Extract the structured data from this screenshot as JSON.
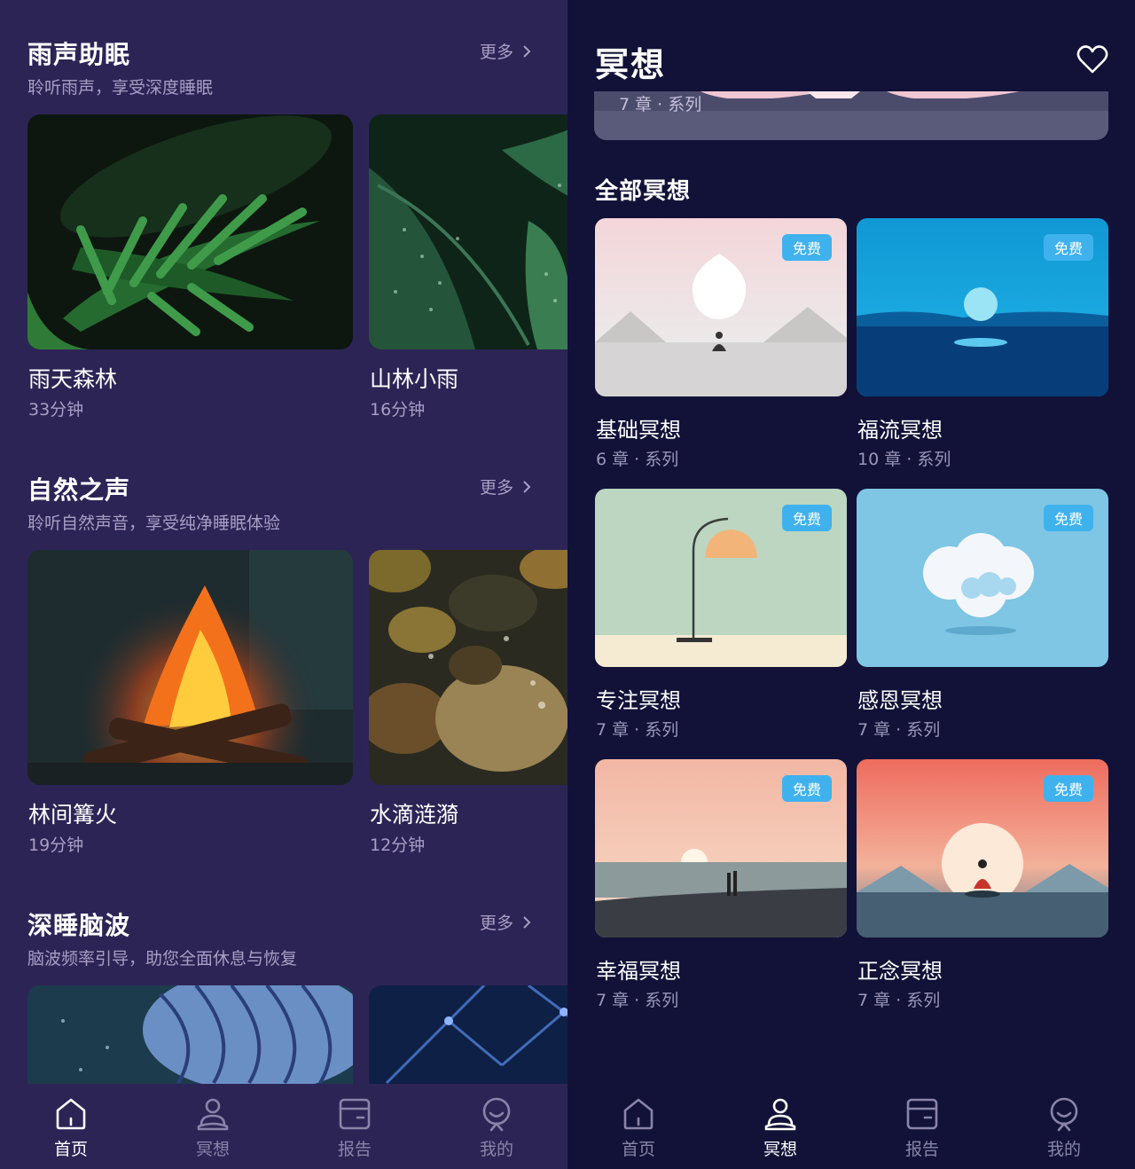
{
  "left_screen": {
    "sections": [
      {
        "title": "雨声助眠",
        "subtitle": "聆听雨声，享受深度睡眠",
        "more_label": "更多",
        "items": [
          {
            "title": "雨天森林",
            "duration": "33分钟"
          },
          {
            "title": "山林小雨",
            "duration": "16分钟"
          }
        ]
      },
      {
        "title": "自然之声",
        "subtitle": "聆听自然声音，享受纯净睡眠体验",
        "more_label": "更多",
        "items": [
          {
            "title": "林间篝火",
            "duration": "19分钟"
          },
          {
            "title": "水滴涟漪",
            "duration": "12分钟"
          }
        ]
      },
      {
        "title": "深睡脑波",
        "subtitle": "脑波频率引导，助您全面休息与恢复",
        "more_label": "更多",
        "items": [
          {
            "title": "",
            "duration": ""
          },
          {
            "title": "",
            "duration": ""
          }
        ]
      }
    ],
    "tabbar": [
      {
        "label": "首页",
        "icon": "home-icon",
        "active": true
      },
      {
        "label": "冥想",
        "icon": "meditation-icon",
        "active": false
      },
      {
        "label": "报告",
        "icon": "report-icon",
        "active": false
      },
      {
        "label": "我的",
        "icon": "profile-icon",
        "active": false
      }
    ]
  },
  "right_screen": {
    "page_title": "冥想",
    "favorite_icon": "heart-icon",
    "banner_meta": "7 章 · 系列",
    "all_section_title": "全部冥想",
    "badge_label": "免费",
    "items": [
      {
        "title": "基础冥想",
        "meta": "6 章 · 系列"
      },
      {
        "title": "福流冥想",
        "meta": "10 章 · 系列"
      },
      {
        "title": "专注冥想",
        "meta": "7 章 · 系列"
      },
      {
        "title": "感恩冥想",
        "meta": "7 章 · 系列"
      },
      {
        "title": "幸福冥想",
        "meta": "7 章 · 系列"
      },
      {
        "title": "正念冥想",
        "meta": "7 章 · 系列"
      }
    ],
    "tabbar": [
      {
        "label": "首页",
        "icon": "home-icon",
        "active": false
      },
      {
        "label": "冥想",
        "icon": "meditation-icon",
        "active": true
      },
      {
        "label": "报告",
        "icon": "report-icon",
        "active": false
      },
      {
        "label": "我的",
        "icon": "profile-icon",
        "active": false
      }
    ]
  },
  "colors": {
    "left_background": "#2d2456",
    "right_background": "#121238",
    "badge": "#3fb2ee",
    "muted_text": "#a79fc4"
  }
}
